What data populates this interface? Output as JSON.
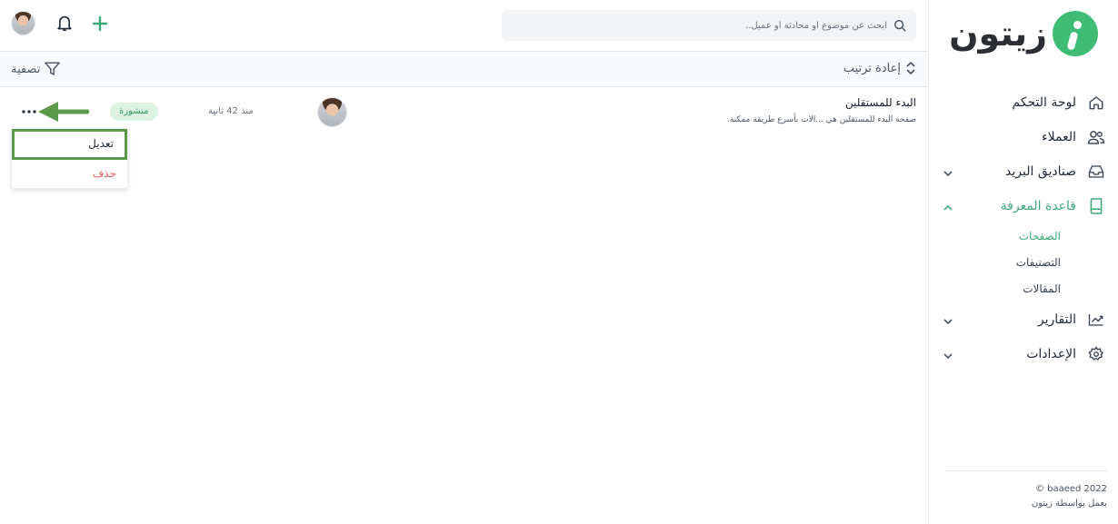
{
  "brand": {
    "name": "زيتون",
    "colors": {
      "accent": "#3fbd77",
      "text": "#2b2f33"
    }
  },
  "sidebar": {
    "items": [
      {
        "label": "لوحة التحكم",
        "icon": "home-icon",
        "has_chevron": false
      },
      {
        "label": "العملاء",
        "icon": "users-icon",
        "has_chevron": false
      },
      {
        "label": "صناديق البريد",
        "icon": "inbox-icon",
        "has_chevron": true,
        "chevron": "chevron-down-icon"
      },
      {
        "label": "قاعدة المعرفة",
        "icon": "book-icon",
        "has_chevron": true,
        "chevron": "chevron-up-icon",
        "active": true
      },
      {
        "label": "التقارير",
        "icon": "chart-icon",
        "has_chevron": true,
        "chevron": "chevron-down-icon"
      },
      {
        "label": "الإعدادات",
        "icon": "gear-icon",
        "has_chevron": true,
        "chevron": "chevron-down-icon"
      }
    ],
    "knowledge_sub": [
      {
        "label": "الصفحات",
        "active": true
      },
      {
        "label": "التصنيفات",
        "active": false
      },
      {
        "label": "المقالات",
        "active": false
      }
    ],
    "footer": {
      "copyright": "© baaeed 2022",
      "powered_by": "يعمل بواسطة زيتون"
    }
  },
  "topbar": {
    "search_placeholder": "ابحث عن موضوع أو محادثة أو عميل..",
    "icons": [
      "search-icon",
      "bell-icon",
      "plus-icon",
      "avatar"
    ]
  },
  "toolbar": {
    "sort_label": "إعادة ترتيب",
    "filter_label": "تصفية"
  },
  "rows": [
    {
      "title": "البدء للمستقلين",
      "description": "صفحة البدء للمستقلين هي ...الات بأسرع طريقة ممكنة.",
      "time": "منذ 42 ثانية",
      "status": "منشورة",
      "status_color": "#3a9b63"
    }
  ],
  "dropdown": {
    "edit_label": "تعديل",
    "delete_label": "حذف",
    "highlight_color": "#5a9a4a",
    "delete_color": "#e05c5c"
  }
}
